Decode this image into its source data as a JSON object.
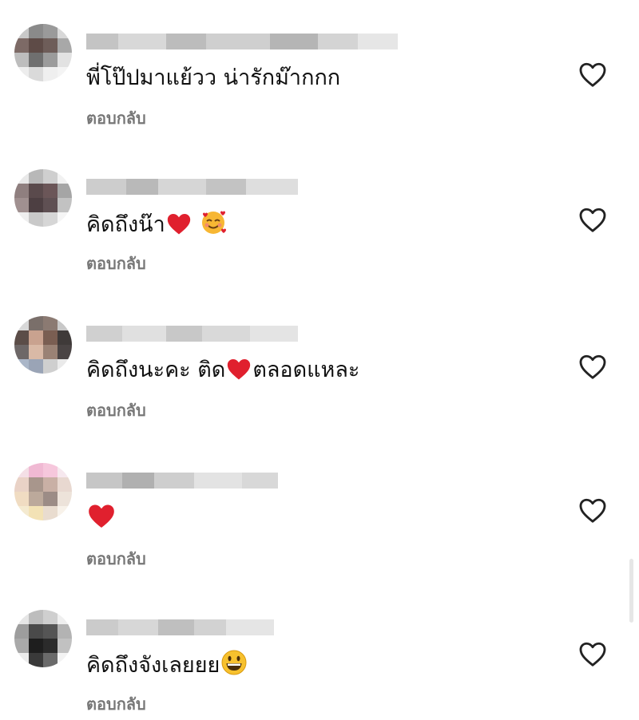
{
  "comments": [
    {
      "text_before": "พี่โป๊ปมาแย้วว น่ารักม๊ากกก",
      "text_after": "",
      "emoji": [],
      "reply_label": "ตอบกลับ",
      "like_icon": "heart-outline-icon"
    },
    {
      "text_before": "คิดถึงน๊า",
      "text_after": "",
      "emoji": [
        "red-heart-icon",
        "smiling-face-with-hearts-icon"
      ],
      "reply_label": "ตอบกลับ",
      "like_icon": "heart-outline-icon"
    },
    {
      "text_before": "คิดถึงนะคะ ติด",
      "text_after": "ตลอดแหละ",
      "emoji": [
        "red-heart-icon"
      ],
      "reply_label": "ตอบกลับ",
      "like_icon": "heart-outline-icon"
    },
    {
      "text_before": "",
      "text_after": "",
      "emoji": [
        "red-heart-icon"
      ],
      "reply_label": "ตอบกลับ",
      "like_icon": "heart-outline-icon"
    },
    {
      "text_before": "คิดถึงจังเลยยย",
      "text_after": "",
      "emoji": [
        "grinning-face-icon"
      ],
      "reply_label": "ตอบกลับ",
      "like_icon": "heart-outline-icon"
    }
  ],
  "colors": {
    "reply": "#777777",
    "heart_outline": "#222222",
    "heart_red": "#e0202e"
  }
}
